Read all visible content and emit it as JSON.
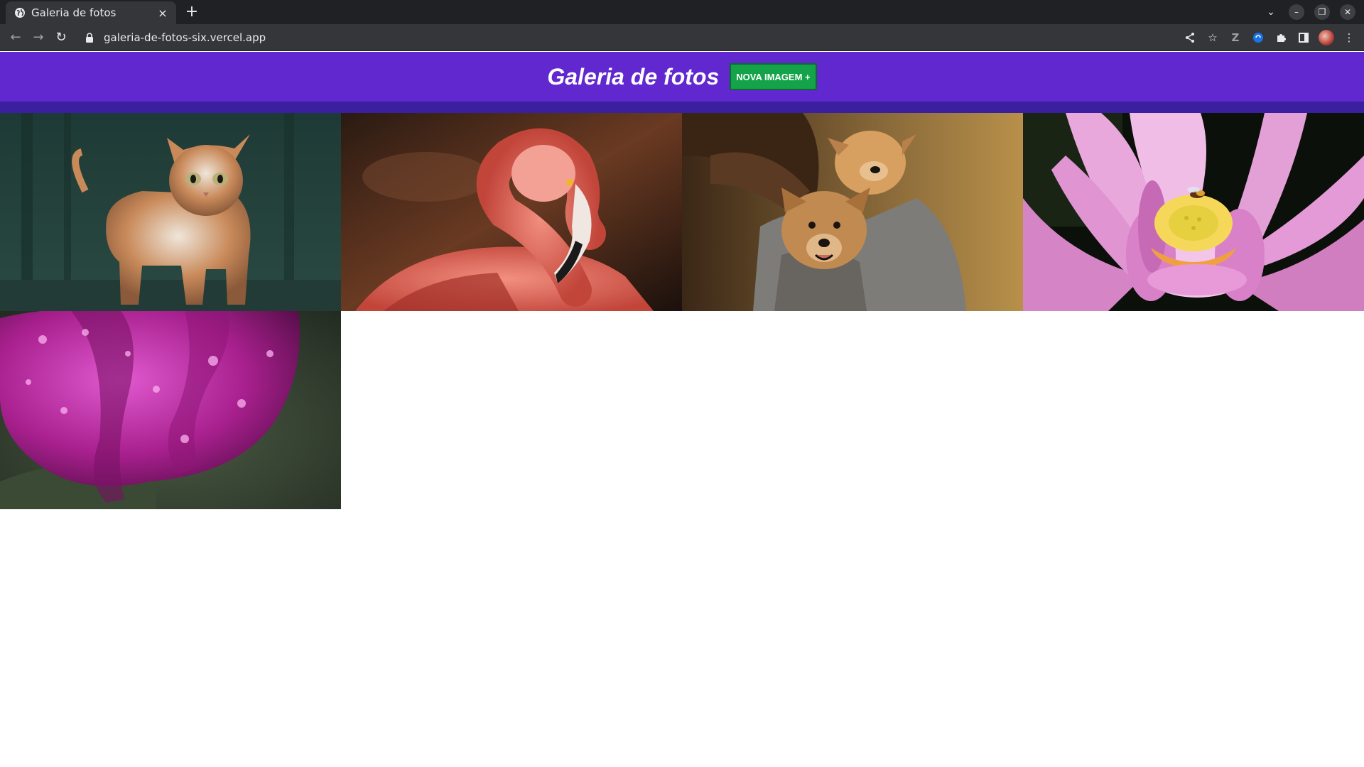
{
  "browser": {
    "tab_title": "Galeria de fotos",
    "tab_close": "×",
    "new_tab": "+",
    "url": "galeria-de-fotos-six.vercel.app"
  },
  "header": {
    "title": "Galeria de fotos",
    "button_label": "NOVA IMAGEM +"
  },
  "colors": {
    "header_bg": "#6228cf",
    "stripe": "#3a1f9e",
    "button_bg": "#15a34a"
  },
  "gallery": {
    "images": [
      {
        "subject": "cat"
      },
      {
        "subject": "flamingo"
      },
      {
        "subject": "puppies"
      },
      {
        "subject": "lotus-flower"
      },
      {
        "subject": "purple-tulip"
      }
    ]
  }
}
